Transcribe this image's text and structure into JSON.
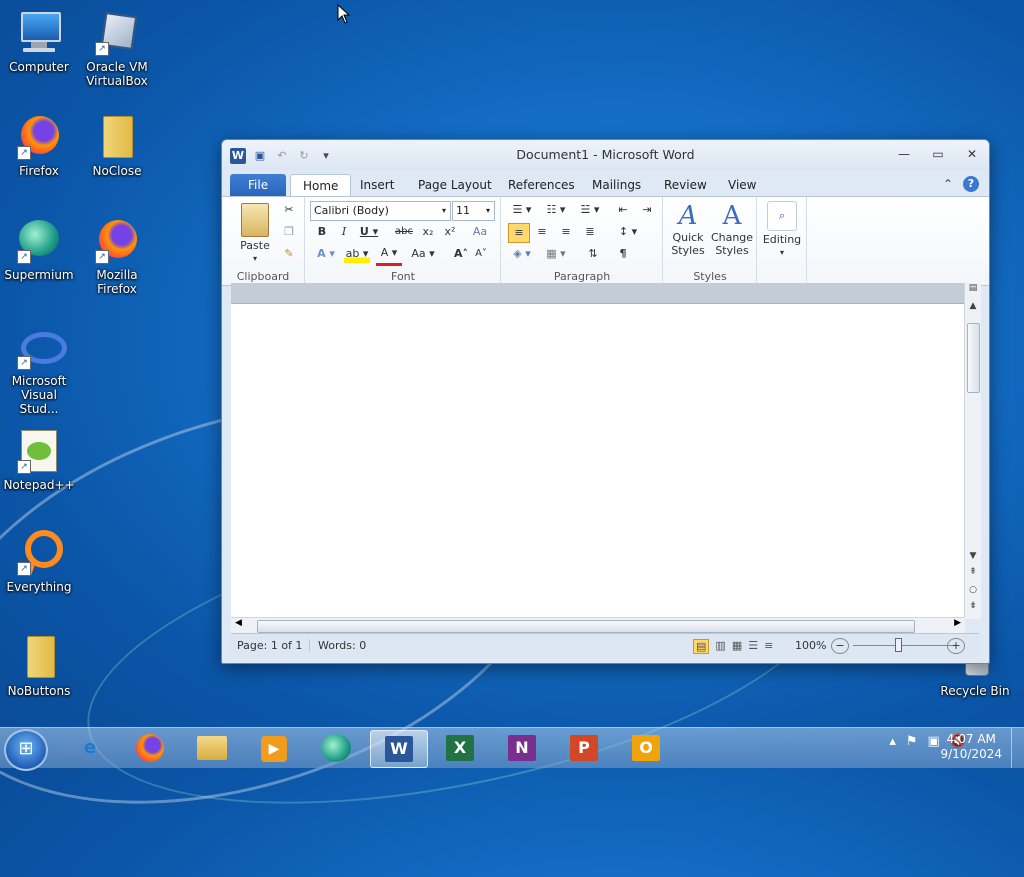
{
  "desktop": {
    "icons": [
      {
        "label": "Computer",
        "icon": "computer-icon"
      },
      {
        "label": "Oracle VM VirtualBox",
        "icon": "virtualbox-icon"
      },
      {
        "label": "Firefox",
        "icon": "firefox-icon"
      },
      {
        "label": "NoClose",
        "icon": "folder-icon"
      },
      {
        "label": "Supermium",
        "icon": "supermium-icon"
      },
      {
        "label": "Mozilla Firefox",
        "icon": "firefox-icon"
      },
      {
        "label": "Microsoft Visual Stud...",
        "icon": "visual-studio-icon"
      },
      {
        "label": "Notepad++",
        "icon": "notepadpp-icon"
      },
      {
        "label": "Everything",
        "icon": "everything-icon"
      },
      {
        "label": "NoButtons",
        "icon": "folder-icon"
      },
      {
        "label": "Recycle Bin",
        "icon": "recycle-bin-icon"
      }
    ]
  },
  "window": {
    "title": "Document1  -  Microsoft Word",
    "tabs": [
      "File",
      "Home",
      "Insert",
      "Page Layout",
      "References",
      "Mailings",
      "Review",
      "View"
    ],
    "active_tab": "Home",
    "ribbon": {
      "clipboard": {
        "label": "Clipboard",
        "paste": "Paste"
      },
      "font": {
        "label": "Font",
        "font_name": "Calibri (Body)",
        "font_size": "11"
      },
      "paragraph": {
        "label": "Paragraph"
      },
      "styles": {
        "label": "Styles",
        "quick_styles": "Quick\nStyles",
        "change_styles": "Change\nStyles"
      },
      "editing": {
        "label": "Editing"
      }
    },
    "status": {
      "page": "Page: 1 of 1",
      "words": "Words: 0",
      "zoom": "100%"
    }
  },
  "taskbar": {
    "apps": [
      "Internet Explorer",
      "Firefox",
      "Windows Explorer",
      "Media Player",
      "Supermium",
      "Microsoft Word",
      "Microsoft Excel",
      "Microsoft OneNote",
      "Microsoft PowerPoint",
      "Microsoft Outlook"
    ],
    "active_app": "Microsoft Word",
    "clock_time": "4:07 AM",
    "clock_date": "9/10/2024"
  },
  "colors": {
    "word_blue": "#2b579a",
    "file_tab": "#2a64b8",
    "taskbar": "#8fb3d9"
  }
}
